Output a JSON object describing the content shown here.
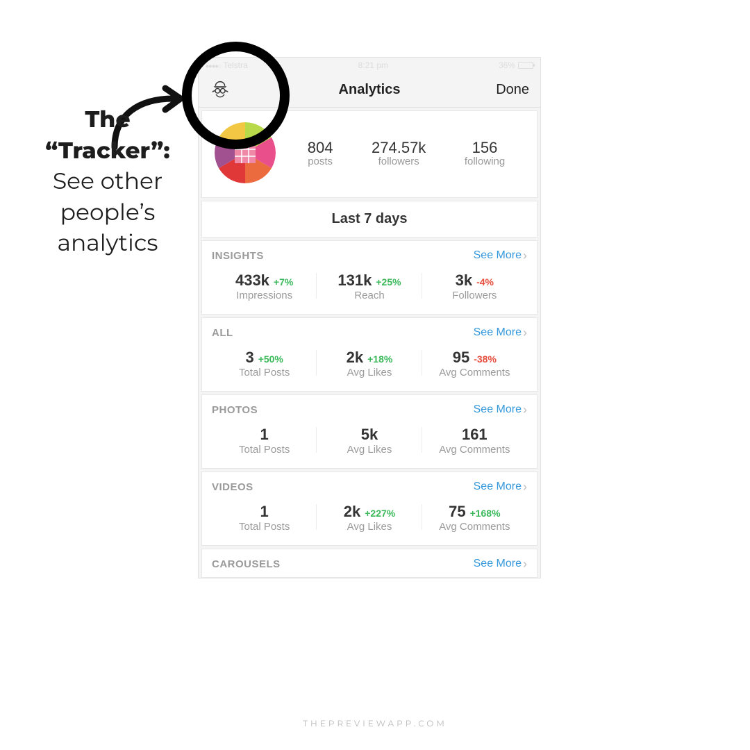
{
  "annotation": {
    "line1": "The",
    "line2": "“Tracker”:",
    "line3": "See other",
    "line4": "people’s",
    "line5": "analytics"
  },
  "statusbar": {
    "carrier": "Telstra",
    "time": "8:21 pm",
    "battery": "36%"
  },
  "navbar": {
    "title": "Analytics",
    "done": "Done"
  },
  "profile": {
    "posts_val": "804",
    "posts_lbl": "posts",
    "followers_val": "274.57k",
    "followers_lbl": "followers",
    "following_val": "156",
    "following_lbl": "following"
  },
  "range_label": "Last 7 days",
  "see_more": "See More",
  "sections": {
    "insights": {
      "title": "INSIGHTS",
      "m1_val": "433k",
      "m1_delta": "+7%",
      "m1_dir": "up",
      "m1_lbl": "Impressions",
      "m2_val": "131k",
      "m2_delta": "+25%",
      "m2_dir": "up",
      "m2_lbl": "Reach",
      "m3_val": "3k",
      "m3_delta": "-4%",
      "m3_dir": "down",
      "m3_lbl": "Followers"
    },
    "all": {
      "title": "ALL",
      "m1_val": "3",
      "m1_delta": "+50%",
      "m1_dir": "up",
      "m1_lbl": "Total Posts",
      "m2_val": "2k",
      "m2_delta": "+18%",
      "m2_dir": "up",
      "m2_lbl": "Avg Likes",
      "m3_val": "95",
      "m3_delta": "-38%",
      "m3_dir": "down",
      "m3_lbl": "Avg Comments"
    },
    "photos": {
      "title": "PHOTOS",
      "m1_val": "1",
      "m1_delta": "",
      "m1_dir": "",
      "m1_lbl": "Total Posts",
      "m2_val": "5k",
      "m2_delta": "",
      "m2_dir": "",
      "m2_lbl": "Avg Likes",
      "m3_val": "161",
      "m3_delta": "",
      "m3_dir": "",
      "m3_lbl": "Avg Comments"
    },
    "videos": {
      "title": "VIDEOS",
      "m1_val": "1",
      "m1_delta": "",
      "m1_dir": "",
      "m1_lbl": "Total Posts",
      "m2_val": "2k",
      "m2_delta": "+227%",
      "m2_dir": "up",
      "m2_lbl": "Avg Likes",
      "m3_val": "75",
      "m3_delta": "+168%",
      "m3_dir": "up",
      "m3_lbl": "Avg Comments"
    },
    "carousels": {
      "title": "CAROUSELS"
    }
  },
  "credit": "THEPREVIEWAPP.COM"
}
